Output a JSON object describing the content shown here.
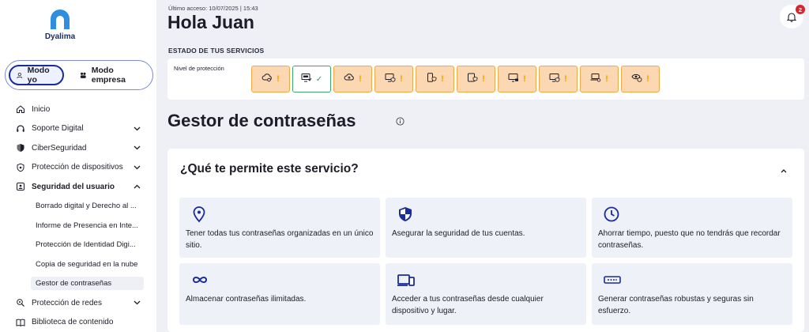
{
  "brand": {
    "name": "Dyalima",
    "accent": "#1a2b9a",
    "logo_color": "#2f8ee0"
  },
  "modes": {
    "personal": "Modo yo",
    "business": "Modo empresa"
  },
  "nav": {
    "inicio": "Inicio",
    "soporte": "Soporte Digital",
    "ciber": "CiberSeguridad",
    "proteccion_dispositivos": "Protección de dispositivos",
    "seguridad_usuario": "Seguridad del usuario",
    "sub": {
      "borrado": "Borrado digital y Derecho al ...",
      "informe": "Informe de Presencia en Inte...",
      "identidad": "Protección de Identidad Digi...",
      "copia": "Copia de seguridad en la nube",
      "gestor": "Gestor de contraseñas"
    },
    "proteccion_redes": "Protección de redes",
    "biblioteca": "Biblioteca de contenido"
  },
  "header": {
    "last_access": "Último acceso: 10/07/2025 | 15:43",
    "greeting": "Hola Juan",
    "notifications_count": "2"
  },
  "services": {
    "title": "ESTADO DE TUS SERVICIOS",
    "protection_label": "Nivel de protección",
    "warning_glyph": "!",
    "check_glyph": "✓",
    "items": [
      {
        "icon": "cloud-gear-icon",
        "status": "warning"
      },
      {
        "icon": "computer-check-icon",
        "status": "ok"
      },
      {
        "icon": "cloud-upload-icon",
        "status": "warning"
      },
      {
        "icon": "computer-shield-icon",
        "status": "warning"
      },
      {
        "icon": "phone-shield-icon",
        "status": "warning"
      },
      {
        "icon": "tablet-shield-icon",
        "status": "warning"
      },
      {
        "icon": "monitor-lock-icon",
        "status": "warning"
      },
      {
        "icon": "monitor-shield-icon",
        "status": "warning"
      },
      {
        "icon": "laptop-shield-icon",
        "status": "warning"
      },
      {
        "icon": "eye-shield-icon",
        "status": "warning"
      }
    ],
    "warning_color": "#f2a100",
    "ok_color": "#2b9a5a"
  },
  "page": {
    "title": "Gestor de contraseñas",
    "question": "¿Qué te permite este servicio?"
  },
  "features": [
    {
      "icon": "location-pin-icon",
      "text": "Tener todas tus contraseñas organizadas en un único sitio."
    },
    {
      "icon": "shield-icon",
      "text": "Asegurar la seguridad de tus cuentas."
    },
    {
      "icon": "clock-icon",
      "text": "Ahorrar tiempo, puesto que no tendrás que recordar contraseñas."
    },
    {
      "icon": "infinity-icon",
      "text": "Almacenar contraseñas ilimitadas."
    },
    {
      "icon": "devices-icon",
      "text": "Acceder a tus contraseñas desde cualquier dispositivo y lugar."
    },
    {
      "icon": "password-field-icon",
      "text": "Generar contraseñas robustas y seguras sin esfuerzo."
    }
  ]
}
